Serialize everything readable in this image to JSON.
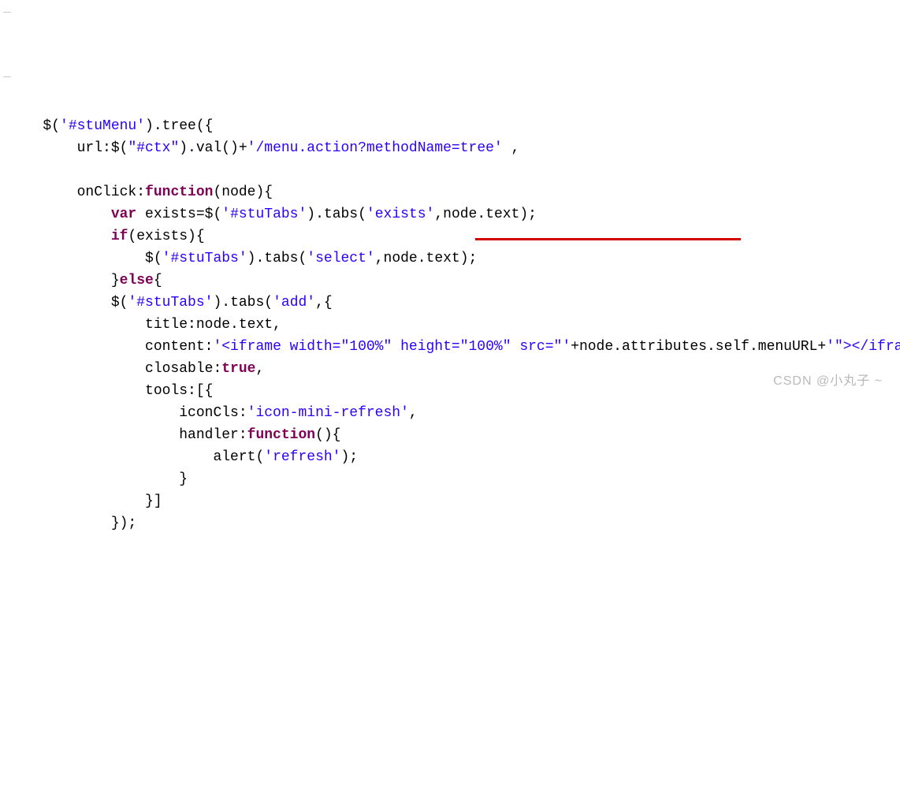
{
  "code": {
    "l01a": "$(",
    "l01b": "'#stuMenu'",
    "l01c": ").tree({",
    "l02a": "url:$(",
    "l02b": "\"#ctx\"",
    "l02c": ").val()+",
    "l02d": "'/menu.action?methodName=tree'",
    "l02e": " ,",
    "l03": "",
    "l04a": "onClick:",
    "l04b": "function",
    "l04c": "(node){",
    "l05a": "var",
    "l05b": " exists=$(",
    "l05c": "'#stuTabs'",
    "l05d": ").tabs(",
    "l05e": "'exists'",
    "l05f": ",node.text);",
    "l06a": "if",
    "l06b": "(exists){",
    "l07a": "$(",
    "l07b": "'#stuTabs'",
    "l07c": ").tabs(",
    "l07d": "'select'",
    "l07e": ",node.text);",
    "l08a": "}",
    "l08b": "else",
    "l08c": "{",
    "l09a": "$(",
    "l09b": "'#stuTabs'",
    "l09c": ").tabs(",
    "l09d": "'add'",
    "l09e": ",{",
    "l10": "title:node.text,",
    "l11a": "content:",
    "l11b": "'<iframe width=\"100%\" height=\"100%\" src=\"'",
    "l11c": "+node.attributes.self.menuURL+",
    "l11d": "'\"></iframe>'",
    "l11e": ",",
    "l12a": "closable:",
    "l12b": "true",
    "l12c": ",",
    "l13": "tools:[{",
    "l14a": "iconCls:",
    "l14b": "'icon-mini-refresh'",
    "l14c": ",",
    "l15a": "handler:",
    "l15b": "function",
    "l15c": "(){",
    "l16a": "alert(",
    "l16b": "'refresh'",
    "l16c": ");",
    "l17": "}",
    "l18": "}]",
    "l19": "});"
  },
  "indent": {
    "i1": "   ",
    "i2": "       ",
    "i3": "           ",
    "i4": "               ",
    "i5": "                   ",
    "i6": "                       "
  },
  "watermark": "CSDN @小丸子 ~"
}
